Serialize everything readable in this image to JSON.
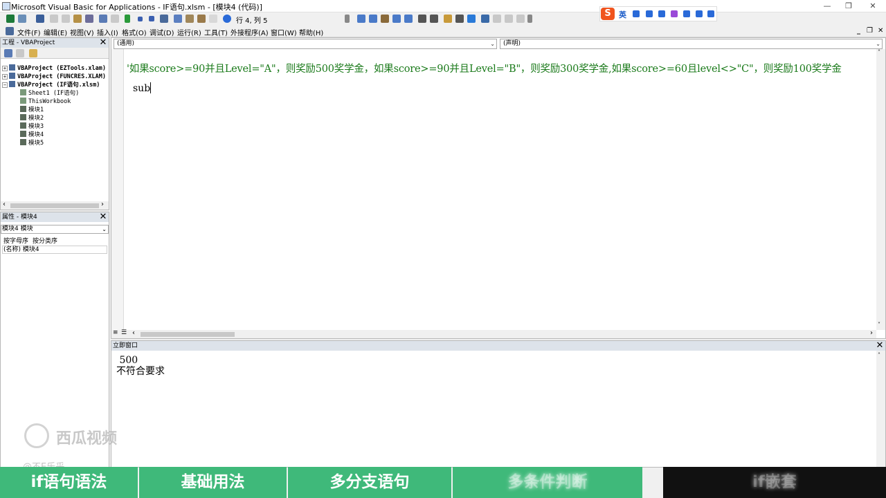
{
  "window": {
    "title": "Microsoft Visual Basic for Applications - IF语句.xlsm - [模块4 (代码)]",
    "controls": [
      "—",
      "❐",
      "✕"
    ]
  },
  "toolbar": {
    "position_text": "行 4, 列 5"
  },
  "ime": {
    "logo": "S",
    "lang": "英"
  },
  "menu": {
    "items": [
      "文件(F)",
      "编辑(E)",
      "视图(V)",
      "插入(I)",
      "格式(O)",
      "调试(D)",
      "运行(R)",
      "工具(T)",
      "外接程序(A)",
      "窗口(W)",
      "帮助(H)"
    ],
    "right_controls": [
      "_",
      "❐",
      "✕"
    ]
  },
  "project_pane": {
    "title": "工程 - VBAProject",
    "tree": [
      {
        "label": "VBAProject (EZTools.xlam)",
        "bold": true
      },
      {
        "label": "VBAProject (FUNCRES.XLAM)",
        "bold": true
      },
      {
        "label": "VBAProject (IF语句.xlsm)",
        "bold": true
      },
      {
        "label": "Sheet1 (IF语句)",
        "bold": false
      },
      {
        "label": "ThisWorkbook",
        "bold": false
      },
      {
        "label": "模块1",
        "bold": false
      },
      {
        "label": "模块2",
        "bold": false
      },
      {
        "label": "模块3",
        "bold": false
      },
      {
        "label": "模块4",
        "bold": false
      },
      {
        "label": "模块5",
        "bold": false
      }
    ]
  },
  "properties_pane": {
    "title": "属性 - 模块4",
    "object_combo": "模块4 模块",
    "tab_alpha": "按字母序",
    "tab_category": "按分类序",
    "name_row": "(名称) 模块4"
  },
  "code_window": {
    "object_dropdown": "(通用)",
    "proc_dropdown": "(声明)",
    "comment_line": "'如果score>=90并且Level=\"A\"，则奖励500奖学金，如果score>=90并且Level=\"B\"，则奖励300奖学金,如果score>=60且level<>\"C\"，则奖励100奖学金",
    "code_line": "sub"
  },
  "immediate_window": {
    "title": "立即窗口",
    "output": [
      " 500",
      "不符合要求"
    ]
  },
  "watermark": {
    "brand": "西瓜视频",
    "user": "@不E乐乎"
  },
  "bottom_nav": {
    "items": [
      "if语句语法",
      "基础用法",
      "多分支语句",
      "多条件判断",
      "if嵌套"
    ]
  }
}
